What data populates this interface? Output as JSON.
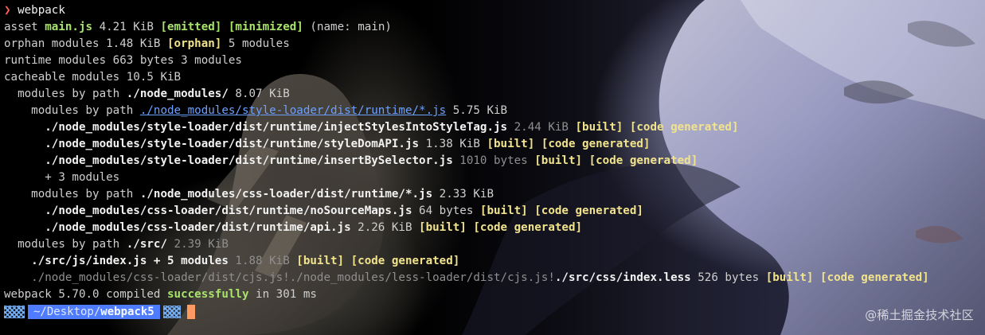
{
  "terminal": {
    "lines": [
      {
        "prefix": "❯",
        "command": "webpack"
      },
      {
        "a1": "asset ",
        "a2": "main.js",
        "a3": " 4.21 KiB ",
        "a4": "[emitted]",
        "a5": " ",
        "a6": "[minimized]",
        "a7": " (name: main)"
      },
      {
        "a1": "orphan modules 1.48 KiB ",
        "a2": "[orphan]",
        "a3": " 5 modules"
      },
      {
        "a1": "runtime modules 663 bytes 3 modules"
      },
      {
        "a1": "cacheable modules 10.5 KiB"
      },
      {
        "a1": "  modules by path ",
        "a2": "./node_modules/",
        "a3": " 8.07 KiB"
      },
      {
        "a1": "    modules by path ",
        "a2": "./node_modules/style-loader/dist/runtime/*.js",
        "a3": " 5.75 KiB"
      },
      {
        "a1": "      ./node_modules/style-loader/dist/runtime/injectStylesIntoStyleTag.js",
        "a2": " 2.44 KiB ",
        "a3": "[built]",
        "a4": " ",
        "a5": "[code generated]"
      },
      {
        "a1": "      ./node_modules/style-loader/dist/runtime/styleDomAPI.js",
        "a2": " 1.38 KiB ",
        "a3": "[built]",
        "a4": " ",
        "a5": "[code generated]"
      },
      {
        "a1": "      ./node_modules/style-loader/dist/runtime/insertBySelector.js",
        "a2": " 1010 bytes ",
        "a3": "[built]",
        "a4": " ",
        "a5": "[code generated]"
      },
      {
        "a1": "      + 3 modules"
      },
      {
        "a1": "    modules by path ",
        "a2": "./node_modules/css-loader/dist/runtime/*.js",
        "a3": " 2.33 KiB"
      },
      {
        "a1": "      ./node_modules/css-loader/dist/runtime/noSourceMaps.js",
        "a2": " 64 bytes ",
        "a3": "[built]",
        "a4": " ",
        "a5": "[code generated]"
      },
      {
        "a1": "      ./node_modules/css-loader/dist/runtime/api.js",
        "a2": " 2.26 KiB ",
        "a3": "[built]",
        "a4": " ",
        "a5": "[code generated]"
      },
      {
        "a1": "  modules by path ",
        "a2": "./src/",
        "a3": " 2.39 KiB"
      },
      {
        "a1": "    ./src/js/index.js + 5 modules",
        "a2": " 1.88 KiB ",
        "a3": "[built]",
        "a4": " ",
        "a5": "[code generated]"
      },
      {
        "a1": "    ./node_modules/css-loader/dist/cjs.js!./node_modules/less-loader/dist/cjs.js!",
        "a2": "./src/css/index.less",
        "a3": " 526 bytes ",
        "a4": "[built]",
        "a5": " ",
        "a6": "[code generated]"
      },
      {
        "a1": "webpack 5.70.0 compiled ",
        "a2": "successfully",
        "a3": " in 301 ms"
      }
    ],
    "prompt": {
      "path_prefix": "~/Desktop/",
      "path_name": "webpack5"
    },
    "watermark": "@稀土掘金技术社区"
  }
}
